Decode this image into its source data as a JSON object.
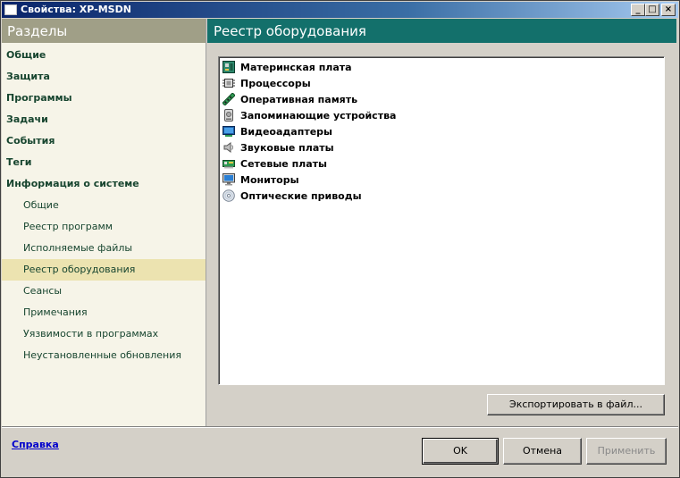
{
  "window": {
    "title": "Свойства: XP-MSDN",
    "min_glyph": "_",
    "max_glyph": "□",
    "close_glyph": "×"
  },
  "sidebar": {
    "header": "Разделы",
    "items": [
      {
        "label": "Общие",
        "level": "main"
      },
      {
        "label": "Защита",
        "level": "main"
      },
      {
        "label": "Программы",
        "level": "main"
      },
      {
        "label": "Задачи",
        "level": "main"
      },
      {
        "label": "События",
        "level": "main"
      },
      {
        "label": "Теги",
        "level": "main"
      },
      {
        "label": "Информация о системе",
        "level": "main"
      },
      {
        "label": "Общие",
        "level": "sub"
      },
      {
        "label": "Реестр программ",
        "level": "sub"
      },
      {
        "label": "Исполняемые файлы",
        "level": "sub"
      },
      {
        "label": "Реестр оборудования",
        "level": "sub",
        "active": true
      },
      {
        "label": "Сеансы",
        "level": "sub"
      },
      {
        "label": "Примечания",
        "level": "sub"
      },
      {
        "label": "Уязвимости в программах",
        "level": "sub"
      },
      {
        "label": "Неустановленные обновления",
        "level": "sub"
      }
    ],
    "help_link": "Справка"
  },
  "panel": {
    "header": "Реестр оборудования",
    "hardware": [
      {
        "label": "Материнская плата",
        "icon": "motherboard-icon"
      },
      {
        "label": "Процессоры",
        "icon": "cpu-icon"
      },
      {
        "label": "Оперативная память",
        "icon": "memory-icon"
      },
      {
        "label": "Запоминающие устройства",
        "icon": "storage-icon"
      },
      {
        "label": "Видеоадаптеры",
        "icon": "video-adapter-icon"
      },
      {
        "label": "Звуковые платы",
        "icon": "speaker-icon"
      },
      {
        "label": "Сетевые платы",
        "icon": "network-card-icon"
      },
      {
        "label": "Мониторы",
        "icon": "monitor-icon"
      },
      {
        "label": "Оптические приводы",
        "icon": "optical-disc-icon"
      }
    ],
    "export_button": "Экспортировать в файл..."
  },
  "footer": {
    "ok": "OK",
    "cancel": "Отмена",
    "apply": "Применить"
  },
  "colors": {
    "sidebar_header": "#a09f87",
    "panel_header": "#13706b",
    "sidebar_bg": "#f6f4e8",
    "active_item": "#ece3b0",
    "nav_text": "#17452f"
  }
}
